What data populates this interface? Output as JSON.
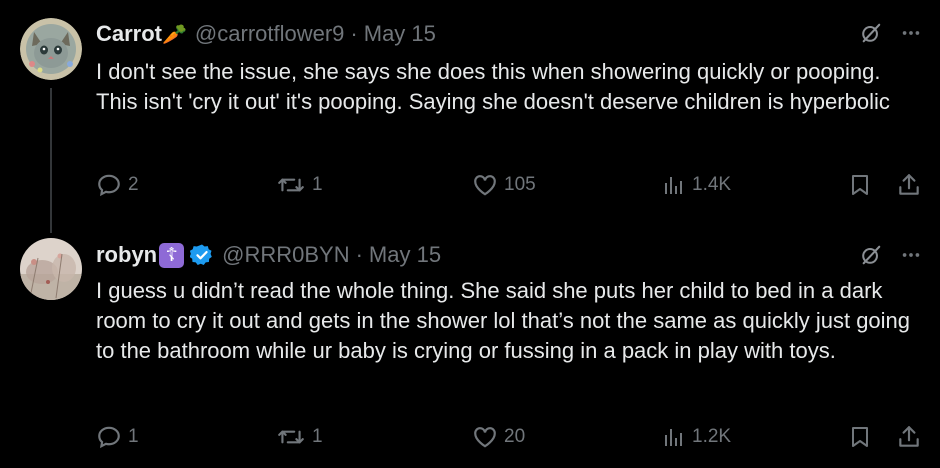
{
  "tweets": [
    {
      "name": "Carrot",
      "name_emoji": "🥕",
      "handle": "@carrotflower9",
      "sep": "·",
      "date": "May 15",
      "text": "I don't see the issue, she says she does this when showering quickly or pooping. This isn't 'cry it out' it's pooping. Saying she doesn't deserve children is hyperbolic",
      "replies": "2",
      "reposts": "1",
      "likes": "105",
      "views": "1.4K"
    },
    {
      "name": "robyn",
      "name_emoji": "☦",
      "handle": "@RRR0BYN",
      "sep": "·",
      "date": "May 15",
      "text": "I guess u didn’t read the whole thing. She said she puts her child to bed in a dark room to cry it out and gets in the shower lol that’s not the same as quickly just going to the bathroom while ur baby is crying or fussing in a pack in play with toys.",
      "replies": "1",
      "reposts": "1",
      "likes": "20",
      "views": "1.2K"
    }
  ],
  "colors": {
    "accent": "#1d9bf0",
    "muted": "#71767b",
    "text": "#e7e9ea",
    "bg": "#000000"
  },
  "icons": [
    "grok-icon",
    "more-icon",
    "reply-icon",
    "repost-icon",
    "like-icon",
    "views-icon",
    "bookmark-icon",
    "share-icon",
    "verified-icon"
  ]
}
